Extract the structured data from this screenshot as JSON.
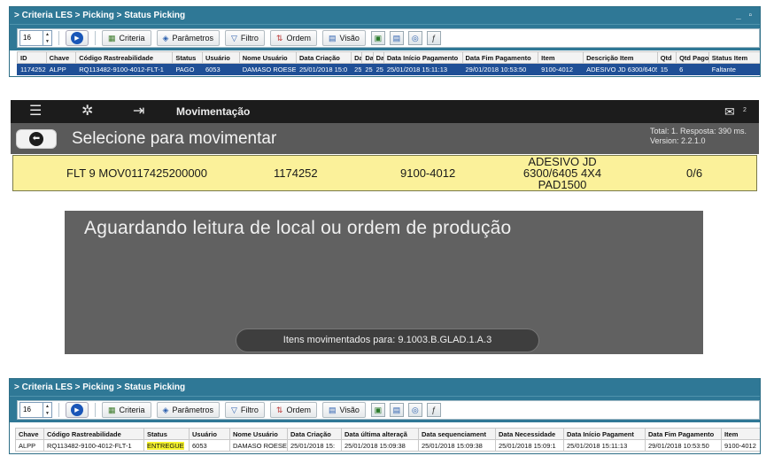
{
  "screen1": {
    "breadcrumb": "> Criteria LES > Picking > Status Picking",
    "window_controls": "_ ▫",
    "spinner_value": "16",
    "buttons": {
      "criteria": "Criteria",
      "parametros": "Parâmetros",
      "filtro": "Filtro",
      "ordem": "Ordem",
      "visao": "Visão"
    },
    "columns": [
      "ID",
      "Chave",
      "Código Rastreabilidade",
      "Status",
      "Usuário",
      "Nome Usuário",
      "Data Criação",
      "Da",
      "Da",
      "Da",
      "Data Início Pagamento",
      "Data Fim Pagamento",
      "Item",
      "Descrição Item",
      "Qtd",
      "Qtd Pago",
      "Status Item"
    ],
    "row": [
      "1174252",
      "ALPP",
      "RQ113482-9100-4012-FLT-1",
      "PAGO",
      "6053",
      "DAMASO ROESE E",
      "25/01/2018 15:0",
      "25",
      "25",
      "25",
      "25/01/2018 15:11:13",
      "29/01/2018 10:53:50",
      "9100-4012",
      "ADESIVO JD 6300/6405",
      "15",
      "6",
      "Faltante"
    ]
  },
  "screen2": {
    "app_title": "Movimentação",
    "heading": "Selecione para movimentar",
    "info_line1": "Total: 1. Resposta: 390 ms.",
    "info_line2": "Version: 2.2.1.0",
    "notif_count": "2",
    "row": {
      "col1": "FLT 9  MOV0117425200000",
      "col2": "1174252",
      "col3": "9100-4012",
      "desc_line1": "ADESIVO JD",
      "desc_line2": "6300/6405 4X4",
      "desc_line3": "PAD1500",
      "col5": "0/6"
    }
  },
  "screen3": {
    "message": "Aguardando leitura de local ou ordem de produção",
    "toast": "Itens movimentados para: 9.1003.B.GLAD.1.A.3"
  },
  "screen4": {
    "breadcrumb": "> Criteria LES > Picking > Status Picking",
    "spinner_value": "16",
    "buttons": {
      "criteria": "Criteria",
      "parametros": "Parâmetros",
      "filtro": "Filtro",
      "ordem": "Ordem",
      "visao": "Visão"
    },
    "columns": [
      "Chave",
      "Código Rastreabilidade",
      "Status",
      "Usuário",
      "Nome Usuário",
      "Data Criação",
      "Data última alteraçã",
      "Data sequenciament",
      "Data Necessidade",
      "Data Início Pagament",
      "Data Fim Pagamento",
      "Item"
    ],
    "row": [
      "ALPP",
      "RQ113482-9100-4012-FLT-1",
      "ENTREGUE",
      "6053",
      "DAMASO ROESE",
      "25/01/2018 15:",
      "25/01/2018 15:09:38",
      "25/01/2018 15:09:38",
      "25/01/2018 15:09:1",
      "25/01/2018 15:11:13",
      "29/01/2018 10:53:50",
      "9100-4012"
    ]
  }
}
